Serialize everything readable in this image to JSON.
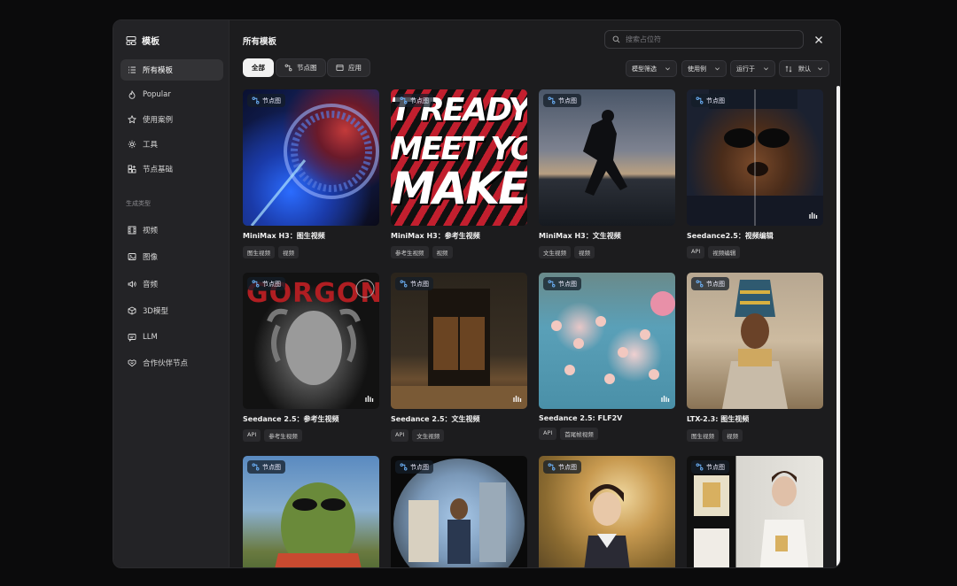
{
  "sidebar": {
    "brand": "模板",
    "nav": [
      {
        "label": "所有模板",
        "icon": "list-icon"
      },
      {
        "label": "Popular",
        "icon": "flame-icon"
      },
      {
        "label": "使用案例",
        "icon": "star-icon"
      },
      {
        "label": "工具",
        "icon": "gear-icon"
      },
      {
        "label": "节点基础",
        "icon": "blocks-icon"
      }
    ],
    "section_label": "生成类型",
    "types": [
      {
        "label": "视频",
        "icon": "film-icon"
      },
      {
        "label": "图像",
        "icon": "image-icon"
      },
      {
        "label": "音频",
        "icon": "speaker-icon"
      },
      {
        "label": "3D模型",
        "icon": "cube-icon"
      },
      {
        "label": "LLM",
        "icon": "chat-icon"
      },
      {
        "label": "合作伙伴节点",
        "icon": "handshake-icon"
      }
    ]
  },
  "header": {
    "title": "所有模板",
    "search_placeholder": "搜索占位符"
  },
  "filters": {
    "chips": [
      "全部",
      "节点图",
      "应用"
    ],
    "dropdowns": [
      "模型筛选",
      "使用例",
      "运行于",
      "默认"
    ]
  },
  "badge_label": "节点图",
  "cards": [
    {
      "title": "MiniMax H3：图生视频",
      "tags": [
        "图生视频",
        "视频"
      ]
    },
    {
      "title": "MiniMax H3：参考生视频",
      "tags": [
        "参考生视频",
        "视频"
      ],
      "poster_text": [
        "T READY",
        "MEET YO",
        "MAKE"
      ]
    },
    {
      "title": "MiniMax H3：文生视频",
      "tags": [
        "文生视频",
        "视频"
      ]
    },
    {
      "title": "Seedance2.5：视频编辑",
      "tags": [
        "API",
        "视频编辑"
      ]
    },
    {
      "title": "Seedance 2.5：参考生视频",
      "tags": [
        "API",
        "参考生视频"
      ],
      "poster_text": [
        "GORGON"
      ]
    },
    {
      "title": "Seedance 2.5：文生视频",
      "tags": [
        "API",
        "文生视频"
      ]
    },
    {
      "title": "Seedance 2.5: FLF2V",
      "tags": [
        "API",
        "首尾帧视频"
      ]
    },
    {
      "title": "LTX-2.3: 图生视频",
      "tags": [
        "图生视频",
        "视频"
      ]
    },
    {
      "title": "",
      "tags": []
    },
    {
      "title": "",
      "tags": []
    },
    {
      "title": "",
      "tags": []
    },
    {
      "title": "",
      "tags": []
    }
  ],
  "colors": {
    "accent": "#f2f2f2",
    "badge_icon": "#6fb6ff",
    "modal_bg": "#1c1c1e"
  }
}
